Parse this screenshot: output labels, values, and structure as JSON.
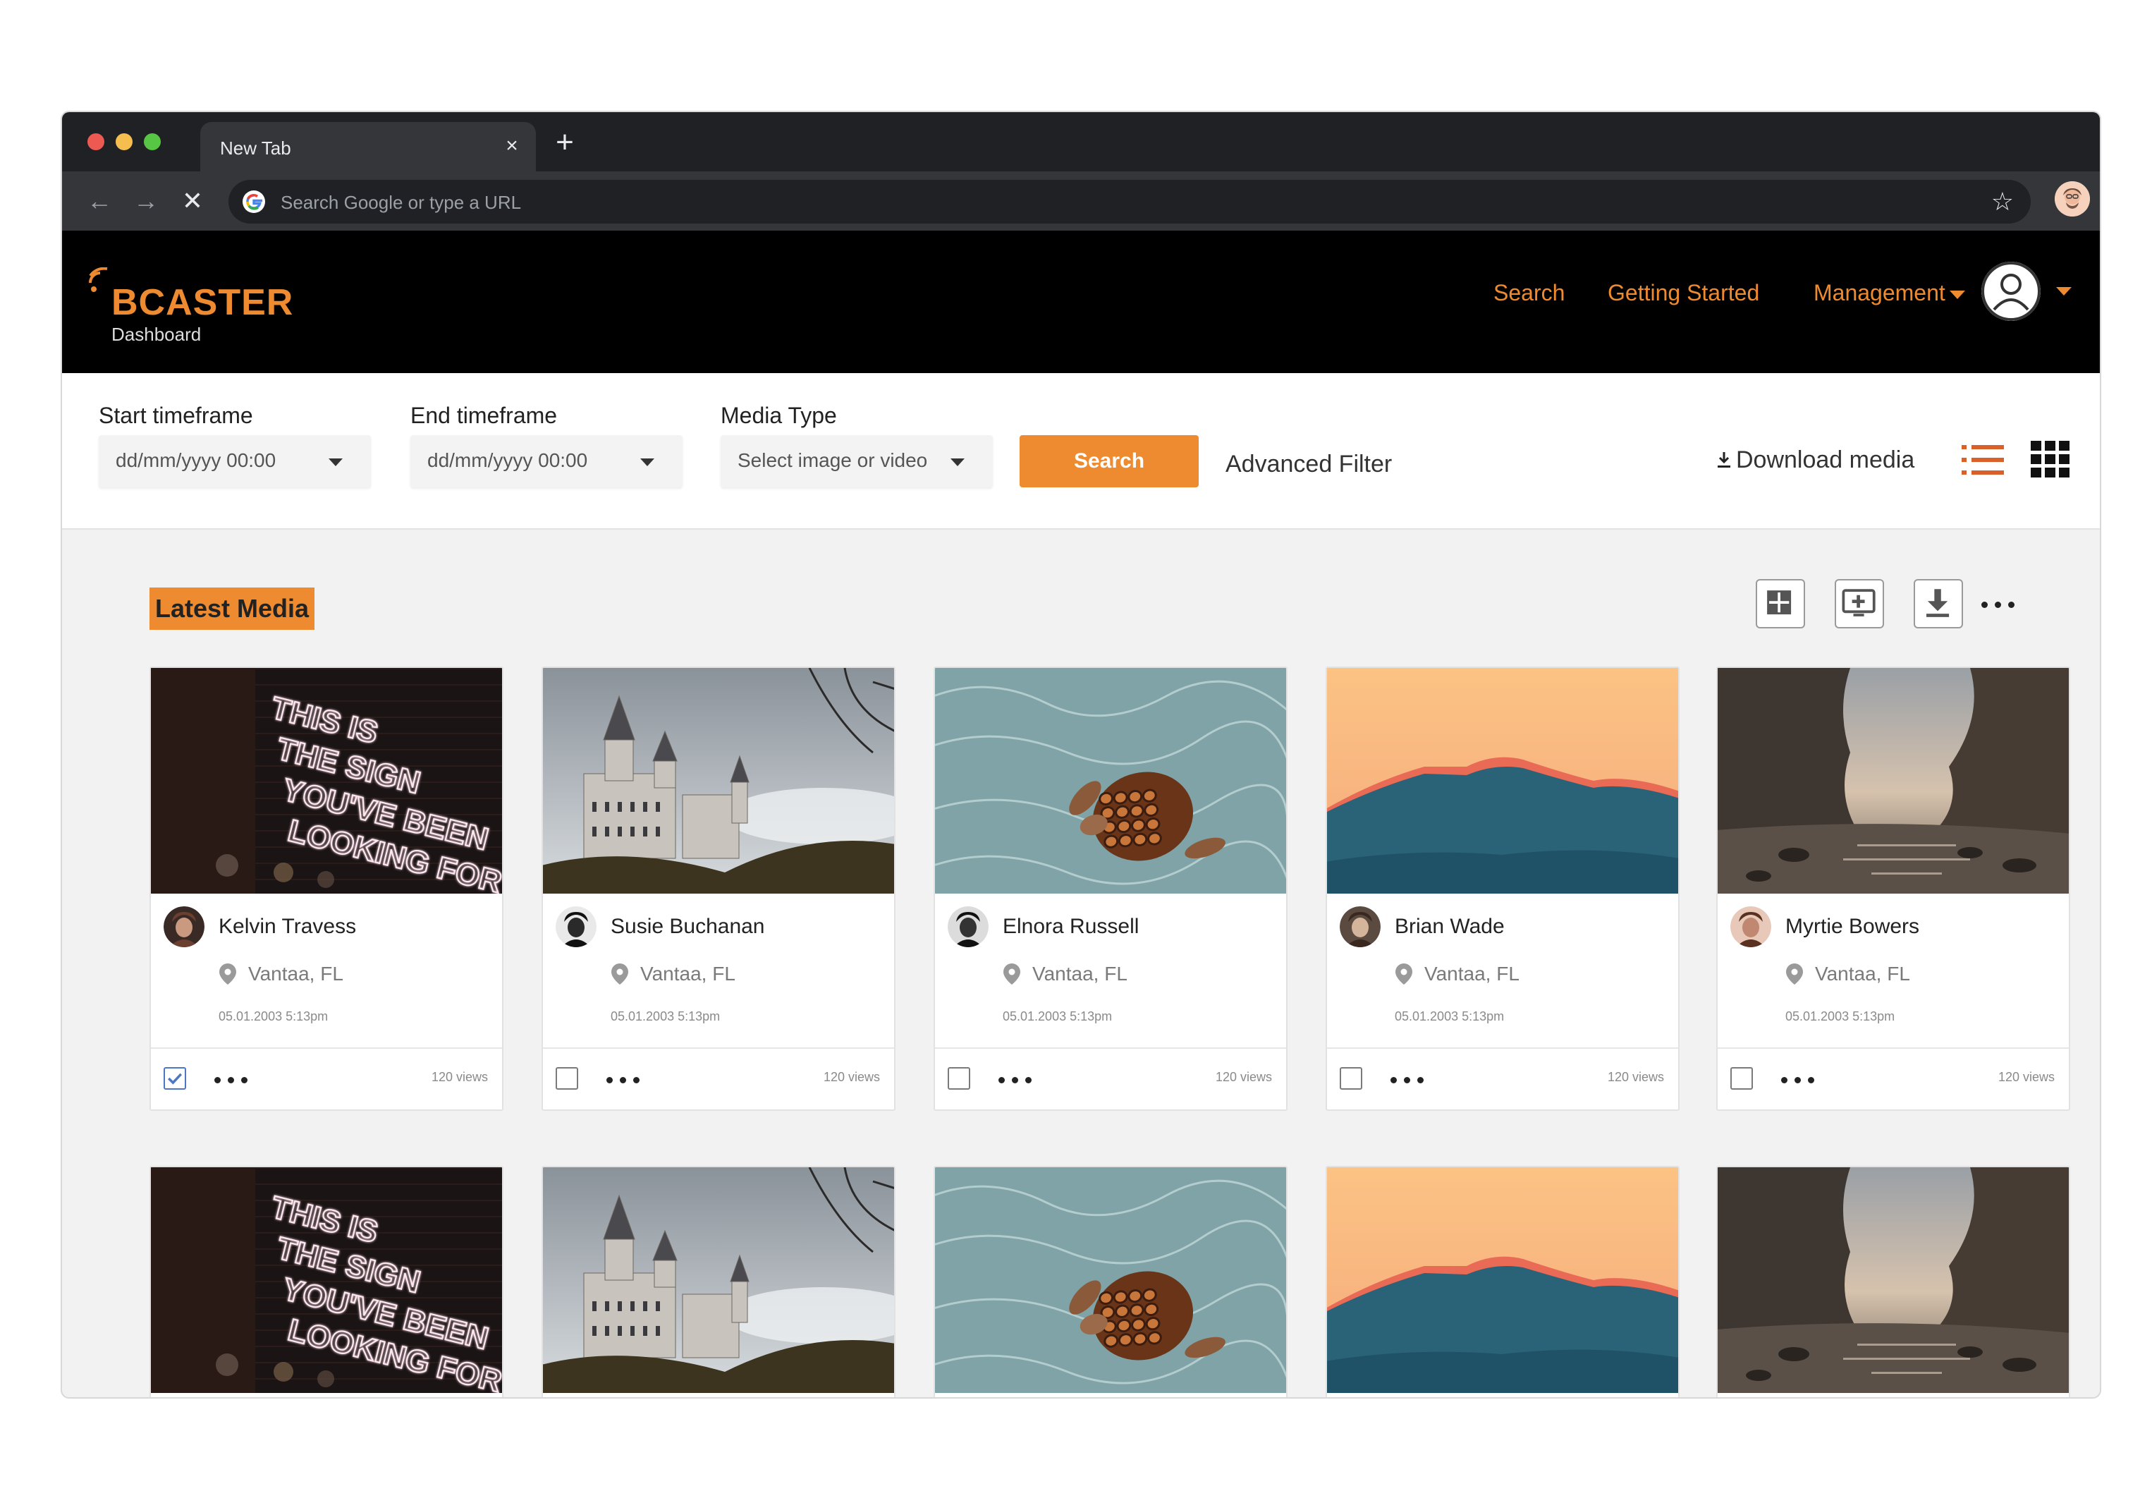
{
  "browser": {
    "tab_title": "New Tab",
    "tab_close": "×",
    "new_tab": "+",
    "omnibox_placeholder": "Search Google or type a URL",
    "back": "←",
    "forward": "→",
    "stop": "✕",
    "bookmark": "☆"
  },
  "header": {
    "logo_word": "BCASTER",
    "logo_sub": "Dashboard",
    "nav": {
      "search": "Search",
      "getting_started": "Getting Started",
      "management": "Management"
    },
    "accent": "#ee8a2f"
  },
  "filters": {
    "start_label": "Start timeframe",
    "start_value": "dd/mm/yyyy 00:00",
    "end_label": "End timeframe",
    "end_value": "dd/mm/yyyy 00:00",
    "media_label": "Media Type",
    "media_value": "Select image or video",
    "search_button": "Search",
    "advanced_filter": "Advanced Filter",
    "download_media": "Download media"
  },
  "content": {
    "section_title": "Latest Media",
    "cards": [
      {
        "name": "Kelvin Travess",
        "location": "Vantaa, FL",
        "date": "05.01.2003  5:13pm",
        "views": "120 views",
        "checked": true,
        "image": "neon-sign"
      },
      {
        "name": "Susie Buchanan",
        "location": "Vantaa, FL",
        "date": "05.01.2003  5:13pm",
        "views": "120 views",
        "checked": false,
        "image": "castle"
      },
      {
        "name": "Elnora Russell",
        "location": "Vantaa, FL",
        "date": "05.01.2003  5:13pm",
        "views": "120 views",
        "checked": false,
        "image": "turtle"
      },
      {
        "name": "Brian Wade",
        "location": "Vantaa, FL",
        "date": "05.01.2003  5:13pm",
        "views": "120 views",
        "checked": false,
        "image": "mountain-sunset"
      },
      {
        "name": "Myrtie Bowers",
        "location": "Vantaa, FL",
        "date": "05.01.2003  5:13pm",
        "views": "120 views",
        "checked": false,
        "image": "rocky-beach"
      }
    ],
    "neon_text": "THIS IS THE SIGN YOU'VE BEEN LOOKING FOR"
  }
}
